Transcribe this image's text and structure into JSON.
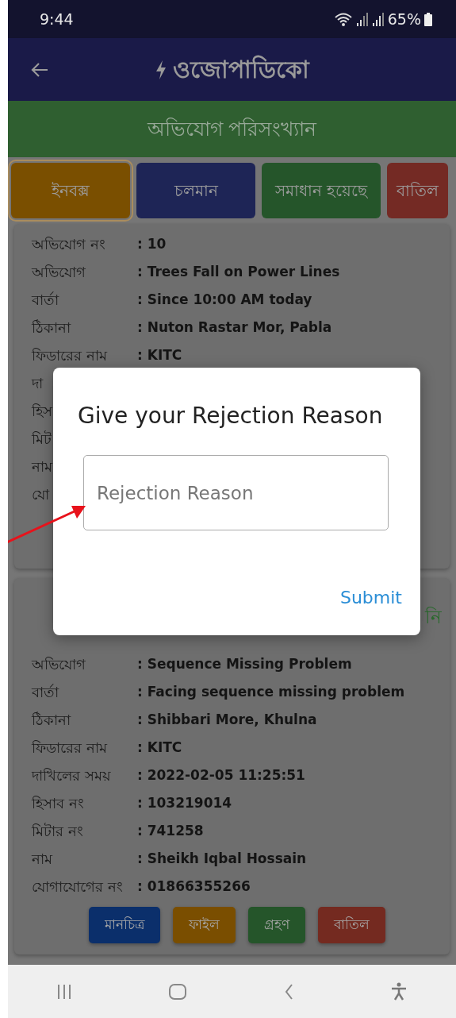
{
  "status_bar": {
    "time": "9:44",
    "battery": "65%"
  },
  "app_bar": {
    "title": "ওজোপাডিকো"
  },
  "section_header": "অভিযোগ পরিসংখ্যান",
  "tabs": [
    {
      "label": "ইনবক্স",
      "color": "#7a4f00",
      "selected": true
    },
    {
      "label": "চলমান",
      "color": "#1e2556",
      "selected": false
    },
    {
      "label": "সমাধান হয়েছে",
      "color": "#25552a",
      "selected": false
    },
    {
      "label": "বাতিল",
      "color": "#742a24",
      "selected": false
    }
  ],
  "complaints": [
    {
      "fields": [
        {
          "label": "অভিযোগ নং",
          "value": ": 10"
        },
        {
          "label": "অভিযোগ",
          "value": ": Trees Fall on Power Lines"
        },
        {
          "label": "বার্তা",
          "value": ": Since 10:00 AM today"
        },
        {
          "label": "ঠিকানা",
          "value": ": Nuton Rastar Mor, Pabla"
        },
        {
          "label": "ফিডারের নাম",
          "value": ": KITC"
        },
        {
          "label": "দা"
        },
        {
          "label": "হিস"
        },
        {
          "label": "মিট"
        },
        {
          "label": "নাম"
        },
        {
          "label": "যো"
        }
      ]
    },
    {
      "status": "নি",
      "fields": [
        {
          "label": "অভিযোগ",
          "value": ": Sequence Missing Problem"
        },
        {
          "label": "বার্তা",
          "value": ": Facing sequence missing problem"
        },
        {
          "label": "ঠিকানা",
          "value": ": Shibbari More, Khulna"
        },
        {
          "label": "ফিডারের নাম",
          "value": ": KITC"
        },
        {
          "label": "দাখিলের সময়",
          "value": ": 2022-02-05 11:25:51"
        },
        {
          "label": "হিসাব নং",
          "value": ": 103219014"
        },
        {
          "label": "মিটার নং",
          "value": ": 741258"
        },
        {
          "label": "নাম",
          "value": ": Sheikh Iqbal Hossain"
        },
        {
          "label": "যোগাযোগের নং",
          "value": ": 01866355266"
        }
      ],
      "actions": [
        {
          "label": "মানচিত্র",
          "color": "#0b2f6b"
        },
        {
          "label": "ফাইল",
          "color": "#7a4e00"
        },
        {
          "label": "গ্রহণ",
          "color": "#25552a"
        },
        {
          "label": "বাতিল",
          "color": "#742a20"
        }
      ]
    }
  ],
  "dialog": {
    "title": "Give your Rejection Reason",
    "placeholder": "Rejection Reason",
    "submit": "Submit"
  }
}
